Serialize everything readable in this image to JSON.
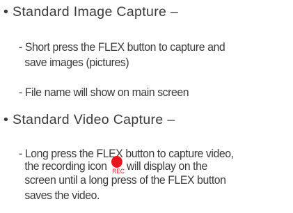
{
  "image_capture": {
    "bullet": "•",
    "title": "Standard Image Capture –",
    "items": [
      {
        "line1": "- Short press the FLEX button to capture and",
        "line2": "save images (pictures)"
      },
      {
        "line1": "- File name will show on main screen"
      }
    ]
  },
  "video_capture": {
    "bullet": "•",
    "title": "Standard Video Capture –",
    "item": {
      "line1": "- Long press the FLEX button to capture video,",
      "line2_before_icon": "the recording icon",
      "line2_after_icon": "will display on the",
      "line3": "screen until a long press of the FLEX button",
      "line4": "saves the video."
    },
    "rec_icon": {
      "name": "rec-icon",
      "label": "REC",
      "color": "#e8141e"
    }
  },
  "colors": {
    "text": "#3a3a3a",
    "accent": "#e8141e"
  }
}
